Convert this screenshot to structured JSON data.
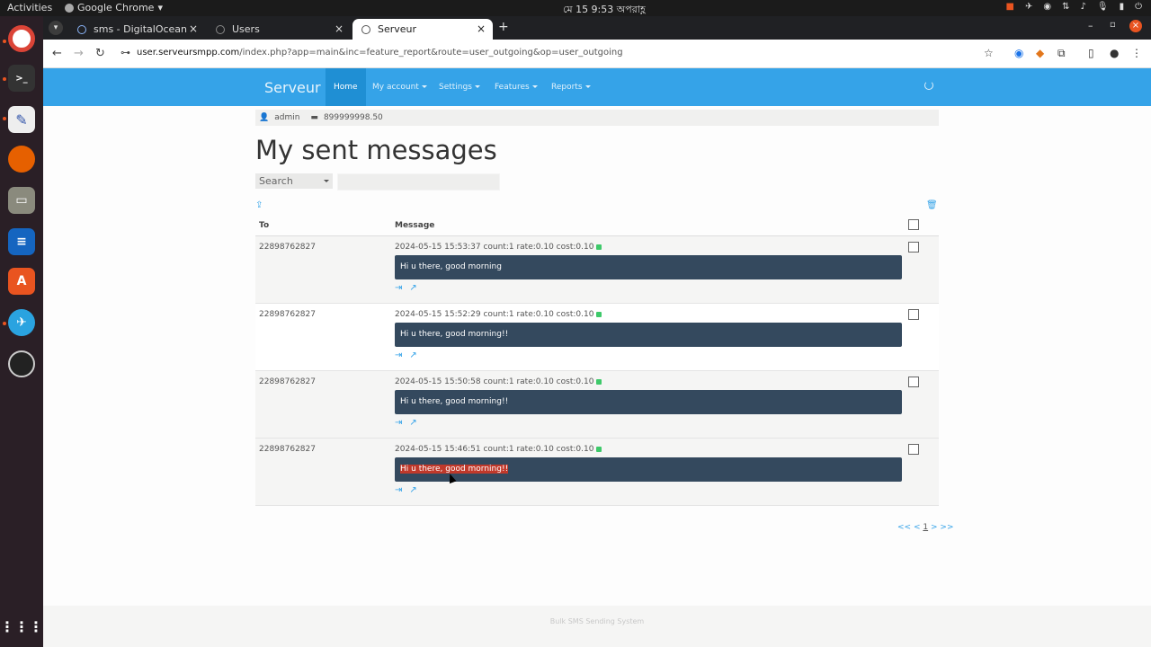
{
  "os": {
    "activities": "Activities",
    "app_name": "Google Chrome",
    "clock": "মে 15  9:53 অপরাহ্ণ"
  },
  "browser": {
    "tabs": [
      {
        "label": "sms - DigitalOcean"
      },
      {
        "label": "Users"
      },
      {
        "label": "Serveur"
      }
    ],
    "url_domain": "user.serveursmpp.com",
    "url_path": "/index.php?app=main&inc=feature_report&route=user_outgoing&op=user_outgoing"
  },
  "site": {
    "brand": "Serveur",
    "nav": [
      "Home",
      "My account",
      "Settings",
      "Features",
      "Reports"
    ],
    "user": "admin",
    "credit": "899999998.50"
  },
  "page": {
    "title": "My sent messages",
    "search_select": "Search",
    "columns": {
      "to": "To",
      "message": "Message"
    },
    "rows": [
      {
        "to": "22898762827",
        "meta": "2024-05-15 15:53:37 count:1 rate:0.10 cost:0.10",
        "message": "Hi u there, good morning"
      },
      {
        "to": "22898762827",
        "meta": "2024-05-15 15:52:29 count:1 rate:0.10 cost:0.10",
        "message": "Hi u there, good morning!!"
      },
      {
        "to": "22898762827",
        "meta": "2024-05-15 15:50:58 count:1 rate:0.10 cost:0.10",
        "message": "Hi u there, good morning!!"
      },
      {
        "to": "22898762827",
        "meta": "2024-05-15 15:46:51 count:1 rate:0.10 cost:0.10",
        "message": "Hi u there, good morning!!"
      }
    ],
    "pager": {
      "first": "<<",
      "prev": "<",
      "current": "1",
      "next": ">",
      "last": ">>"
    },
    "footer": "Bulk SMS Sending System"
  },
  "colors": {
    "navbar": "#35a3e8",
    "message_bg": "#34495e",
    "status_ok": "#3ec96a"
  }
}
